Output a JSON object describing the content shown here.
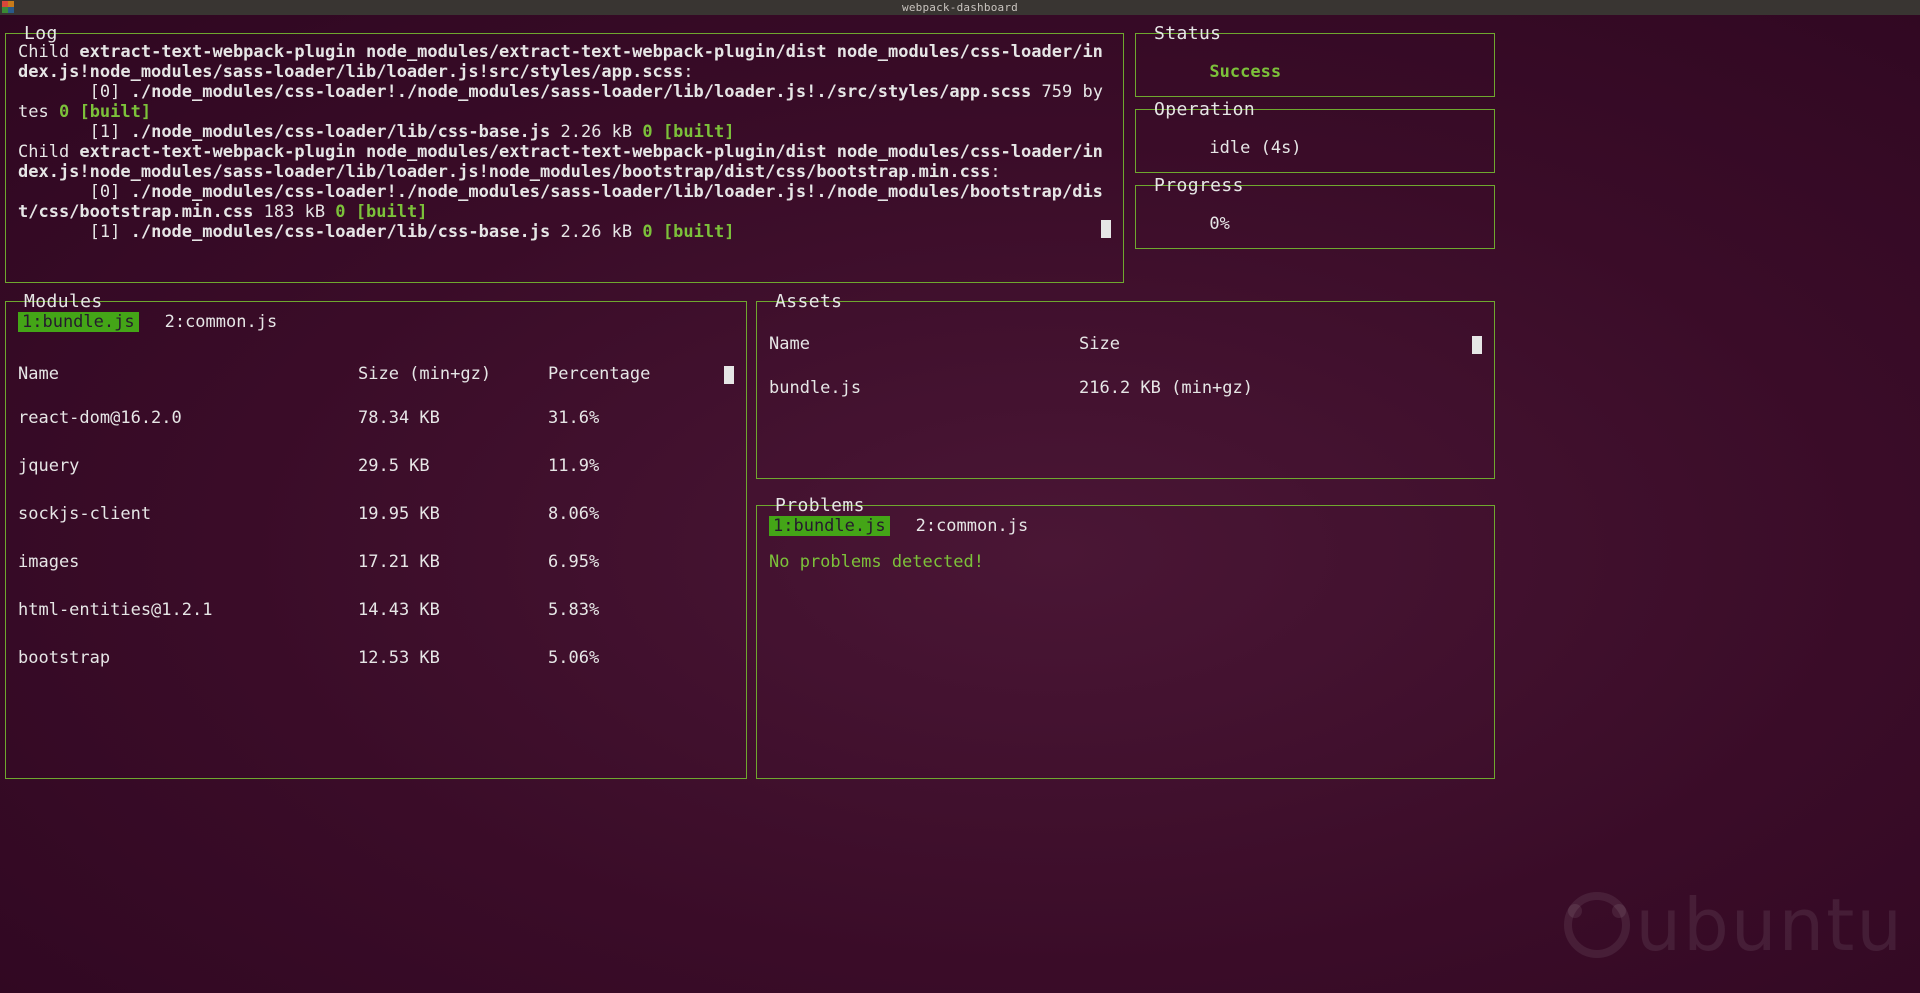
{
  "window": {
    "title": "webpack-dashboard"
  },
  "panes": {
    "log": {
      "title": "Log"
    },
    "status": {
      "title": "Status",
      "value": "Success"
    },
    "operation": {
      "title": "Operation",
      "value": "idle (4s)"
    },
    "progress": {
      "title": "Progress",
      "value": "0%"
    },
    "modules": {
      "title": "Modules"
    },
    "assets": {
      "title": "Assets"
    },
    "problems": {
      "title": "Problems"
    }
  },
  "log": {
    "l1_a": "Child ",
    "l1_b": "extract-text-webpack-plugin node_modules/extract-text-webpack-plugin/dist node_modules/css-loader/index.js!node_modules/sass-loader/lib/loader.js!src/styles/app.scss",
    "l1_c": ":",
    "l2_a": "       [0] ",
    "l2_b": "./node_modules/css-loader!./node_modules/sass-loader/lib/loader.js!./src/styles/app.scss",
    "l2_c": " 759 bytes ",
    "l2_d": "0",
    "l2_e": " ",
    "l2_f": "[built]",
    "l3_a": "       [1] ",
    "l3_b": "./node_modules/css-loader/lib/css-base.js",
    "l3_c": " 2.26 kB ",
    "l3_d": "0",
    "l3_e": " ",
    "l3_f": "[built]",
    "l4_a": "Child ",
    "l4_b": "extract-text-webpack-plugin node_modules/extract-text-webpack-plugin/dist node_modules/css-loader/index.js!node_modules/sass-loader/lib/loader.js!node_modules/bootstrap/dist/css/bootstrap.min.css",
    "l4_c": ":",
    "l5_a": "       [0] ",
    "l5_b": "./node_modules/css-loader!./node_modules/sass-loader/lib/loader.js!./node_modules/bootstrap/dist/css/bootstrap.min.css",
    "l5_c": " 183 kB ",
    "l5_d": "0",
    "l5_e": " ",
    "l5_f": "[built]",
    "l6_a": "       [1] ",
    "l6_b": "./node_modules/css-loader/lib/css-base.js",
    "l6_c": " 2.26 kB ",
    "l6_d": "0",
    "l6_e": " ",
    "l6_f": "[built]"
  },
  "modules": {
    "tabs": [
      {
        "label": "1:bundle.js",
        "active": true
      },
      {
        "label": "2:common.js",
        "active": false
      }
    ],
    "headers": {
      "name": "Name",
      "size": "Size (min+gz)",
      "pct": "Percentage"
    },
    "rows": [
      {
        "name": "react-dom@16.2.0",
        "size": "78.34 KB",
        "pct": "31.6%"
      },
      {
        "name": "jquery",
        "size": "29.5 KB",
        "pct": "11.9%"
      },
      {
        "name": "sockjs-client",
        "size": "19.95 KB",
        "pct": "8.06%"
      },
      {
        "name": "images",
        "size": "17.21 KB",
        "pct": "6.95%"
      },
      {
        "name": "html-entities@1.2.1",
        "size": "14.43 KB",
        "pct": "5.83%"
      },
      {
        "name": "bootstrap",
        "size": "12.53 KB",
        "pct": "5.06%"
      }
    ]
  },
  "assets": {
    "headers": {
      "name": "Name",
      "size": "Size"
    },
    "rows": [
      {
        "name": "bundle.js",
        "size": "216.2 KB (min+gz)"
      }
    ]
  },
  "problems": {
    "tabs": [
      {
        "label": "1:bundle.js",
        "active": true
      },
      {
        "label": "2:common.js",
        "active": false
      }
    ],
    "message": "No problems detected!"
  },
  "branding": {
    "word": "ubuntu"
  }
}
